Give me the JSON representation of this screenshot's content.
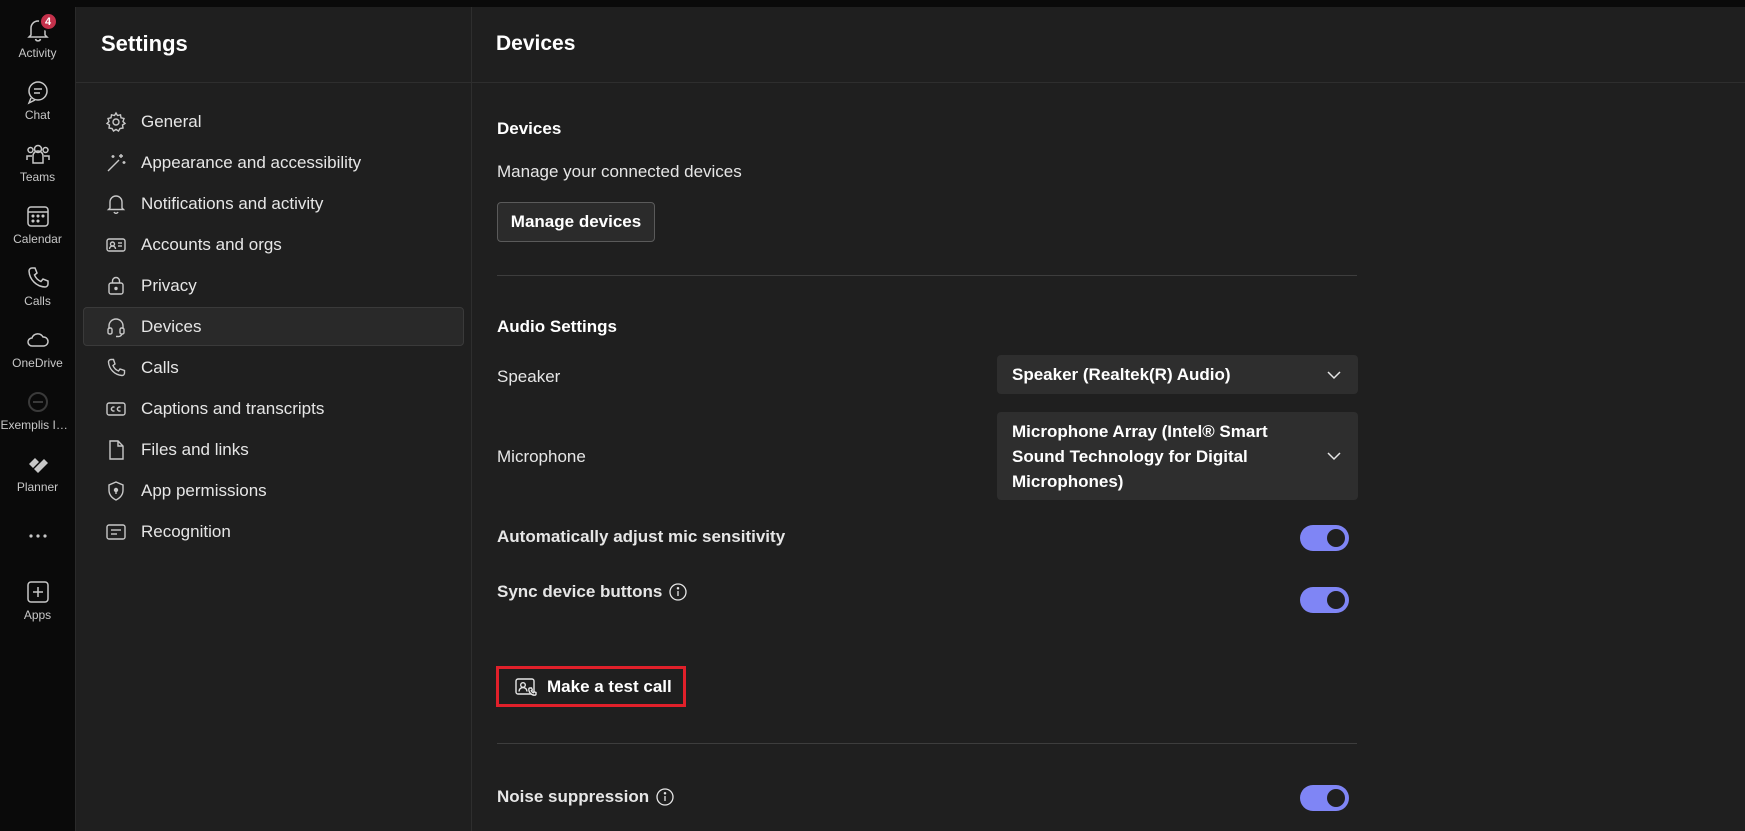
{
  "rail": {
    "items": [
      {
        "label": "Activity",
        "icon": "bell-icon",
        "badge": "4"
      },
      {
        "label": "Chat",
        "icon": "chat-icon"
      },
      {
        "label": "Teams",
        "icon": "teams-icon"
      },
      {
        "label": "Calendar",
        "icon": "calendar-icon"
      },
      {
        "label": "Calls",
        "icon": "phone-icon"
      },
      {
        "label": "OneDrive",
        "icon": "cloud-icon"
      },
      {
        "label": "Exemplis IT ...",
        "icon": "app-icon"
      },
      {
        "label": "Planner",
        "icon": "planner-icon"
      },
      {
        "label": "",
        "icon": "more-icon"
      },
      {
        "label": "Apps",
        "icon": "add-apps-icon"
      }
    ]
  },
  "sidebar": {
    "title": "Settings",
    "items": [
      {
        "label": "General",
        "icon": "gear-icon"
      },
      {
        "label": "Appearance and accessibility",
        "icon": "magic-wand-icon"
      },
      {
        "label": "Notifications and activity",
        "icon": "bell-icon"
      },
      {
        "label": "Accounts and orgs",
        "icon": "id-card-icon"
      },
      {
        "label": "Privacy",
        "icon": "lock-icon"
      },
      {
        "label": "Devices",
        "icon": "headset-icon",
        "active": true
      },
      {
        "label": "Calls",
        "icon": "phone-icon"
      },
      {
        "label": "Captions and transcripts",
        "icon": "cc-icon"
      },
      {
        "label": "Files and links",
        "icon": "document-icon"
      },
      {
        "label": "App permissions",
        "icon": "shield-icon"
      },
      {
        "label": "Recognition",
        "icon": "recognition-icon"
      }
    ]
  },
  "main": {
    "title": "Devices",
    "devices_section": {
      "title": "Devices",
      "description": "Manage your connected devices",
      "manage_button": "Manage devices"
    },
    "audio": {
      "title": "Audio Settings",
      "speaker_label": "Speaker",
      "speaker_value": "Speaker (Realtek(R) Audio)",
      "microphone_label": "Microphone",
      "microphone_value": "Microphone Array (Intel® Smart Sound Technology for Digital Microphones)",
      "auto_mic_label": "Automatically adjust mic sensitivity",
      "auto_mic_on": true,
      "sync_label": "Sync device buttons",
      "sync_on": true,
      "test_call_button": "Make a test call"
    },
    "noise": {
      "label": "Noise suppression",
      "on": true
    }
  },
  "colors": {
    "accent": "#7f85f5",
    "highlight_border": "#e0202a",
    "badge": "#c4314b"
  }
}
